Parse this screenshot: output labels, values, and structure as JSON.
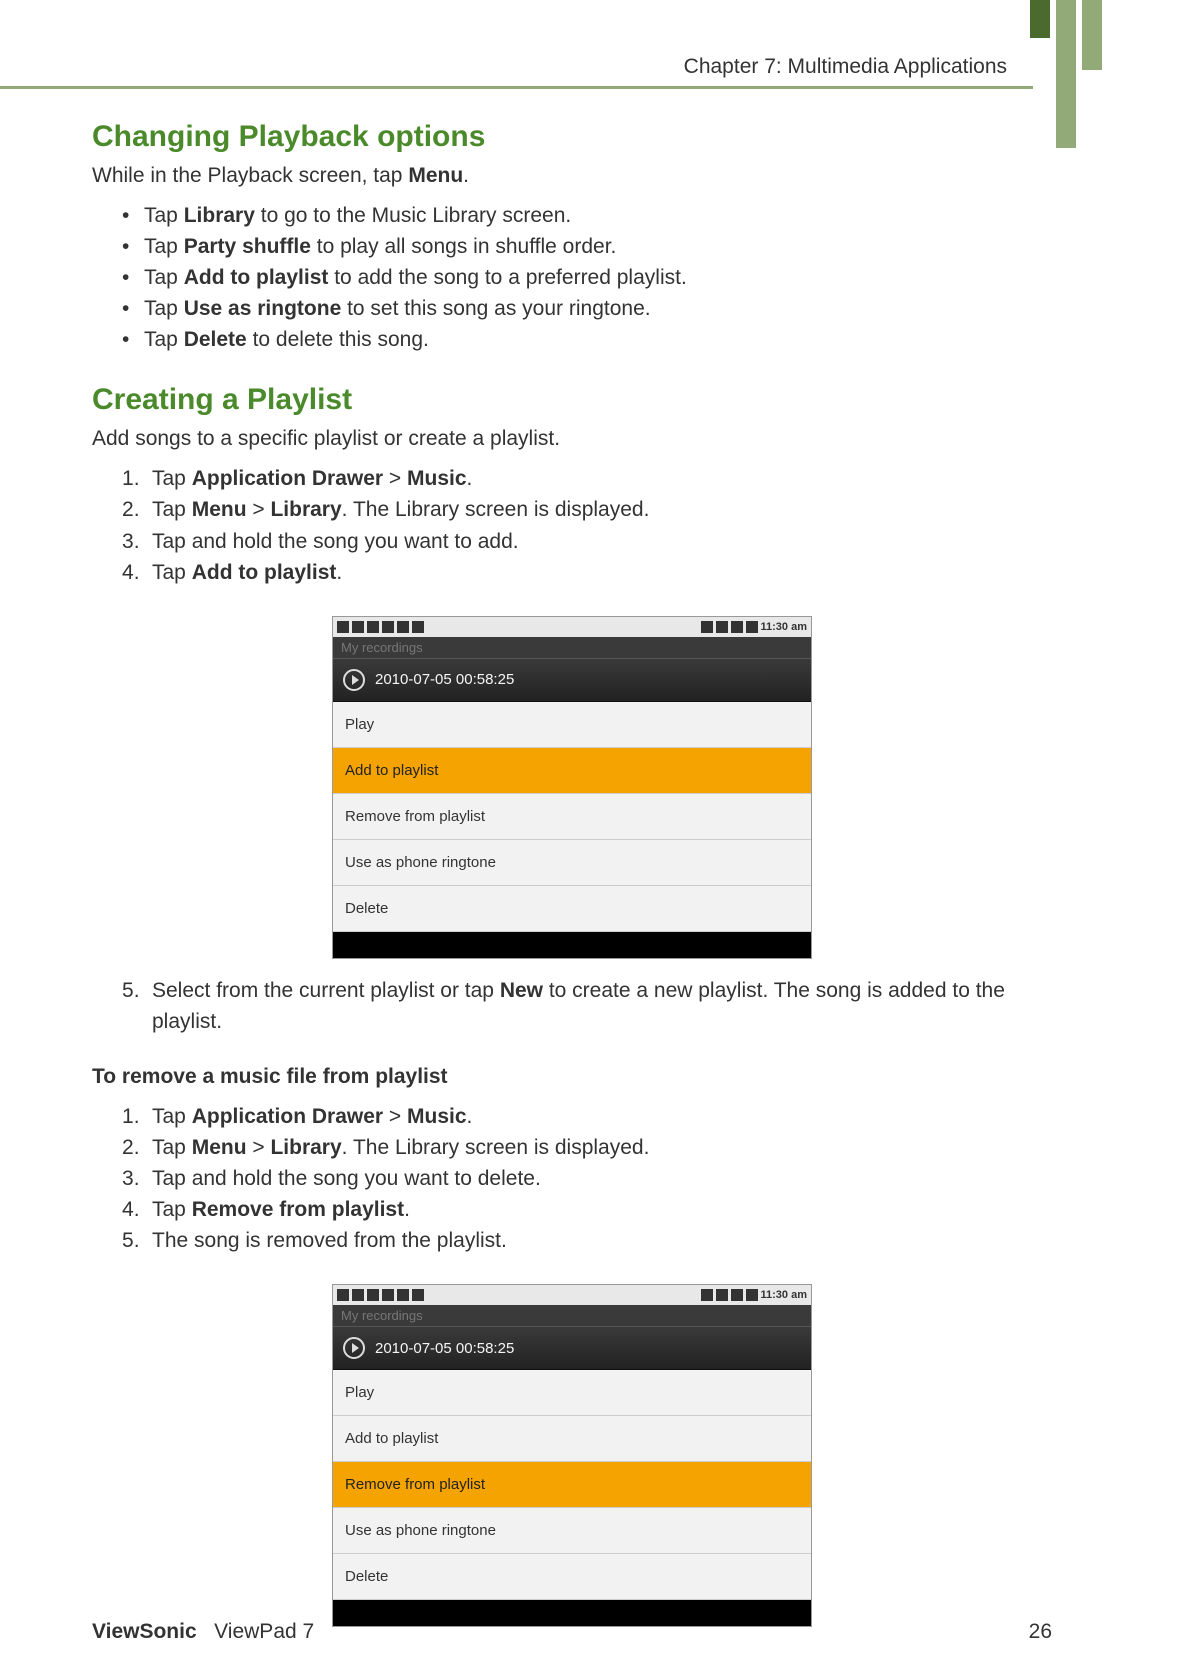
{
  "chapter_label": "Chapter 7: Multimedia Applications",
  "section1": {
    "heading": "Changing Playback options",
    "intro_pre": "While in the Playback screen, tap ",
    "intro_bold": "Menu",
    "intro_post": ".",
    "bullets": [
      {
        "pre": "Tap ",
        "bold": "Library",
        "post": " to go to the Music Library screen."
      },
      {
        "pre": "Tap ",
        "bold": "Party shuffle",
        "post": " to play all songs in shuffle order."
      },
      {
        "pre": "Tap ",
        "bold": "Add to playlist",
        "post": " to add the song to a preferred playlist."
      },
      {
        "pre": "Tap ",
        "bold": "Use as ringtone",
        "post": " to set this song as your ringtone."
      },
      {
        "pre": "Tap ",
        "bold": "Delete",
        "post": " to delete this song."
      }
    ]
  },
  "section2": {
    "heading": "Creating a Playlist",
    "intro": "Add songs to a specific playlist or create a playlist.",
    "steps": [
      {
        "pre": "Tap ",
        "bold": "Application Drawer",
        "mid": " > ",
        "bold2": "Music",
        "post": "."
      },
      {
        "pre": "Tap ",
        "bold": "Menu",
        "mid": " > ",
        "bold2": "Library",
        "post": ". The Library screen is displayed."
      },
      {
        "pre": "Tap and hold the song you want to add.",
        "bold": "",
        "mid": "",
        "bold2": "",
        "post": ""
      },
      {
        "pre": "Tap ",
        "bold": "Add to playlist",
        "mid": "",
        "bold2": "",
        "post": "."
      }
    ],
    "step5_pre": "Select from the current playlist or tap ",
    "step5_bold": "New",
    "step5_post": " to create a new playlist. The song is added to the playlist."
  },
  "section3": {
    "heading": "To remove a music file from playlist",
    "steps": [
      {
        "pre": "Tap ",
        "bold": "Application Drawer",
        "mid": " > ",
        "bold2": "Music",
        "post": "."
      },
      {
        "pre": "Tap ",
        "bold": "Menu",
        "mid": " > ",
        "bold2": "Library",
        "post": ". The Library screen is displayed."
      },
      {
        "pre": "Tap and hold the song you want to delete.",
        "bold": "",
        "mid": "",
        "bold2": "",
        "post": ""
      },
      {
        "pre": "Tap ",
        "bold": "Remove from playlist",
        "mid": "",
        "bold2": "",
        "post": "."
      },
      {
        "pre": "The song is removed from the playlist.",
        "bold": "",
        "mid": "",
        "bold2": "",
        "post": ""
      }
    ]
  },
  "screenshot1": {
    "time": "11:30 am",
    "tab": "My recordings",
    "title": "2010-07-05 00:58:25",
    "items": [
      {
        "label": "Play",
        "selected": false
      },
      {
        "label": "Add to playlist",
        "selected": true
      },
      {
        "label": "Remove from playlist",
        "selected": false
      },
      {
        "label": "Use as phone ringtone",
        "selected": false
      },
      {
        "label": "Delete",
        "selected": false
      }
    ]
  },
  "screenshot2": {
    "time": "11:30 am",
    "tab": "My recordings",
    "title": "2010-07-05 00:58:25",
    "items": [
      {
        "label": "Play",
        "selected": false
      },
      {
        "label": "Add to playlist",
        "selected": false
      },
      {
        "label": "Remove from playlist",
        "selected": true
      },
      {
        "label": "Use as phone ringtone",
        "selected": false
      },
      {
        "label": "Delete",
        "selected": false
      }
    ]
  },
  "footer": {
    "brand": "ViewSonic",
    "product": "ViewPad 7",
    "page": "26"
  }
}
